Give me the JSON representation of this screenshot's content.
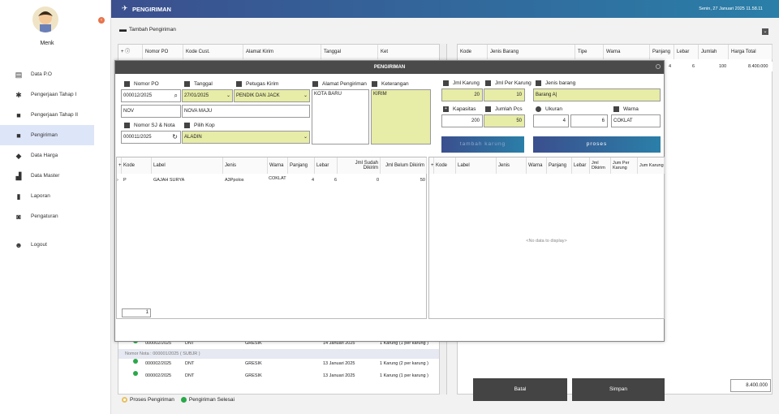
{
  "sidebar": {
    "user": "Menk",
    "items": [
      {
        "label": "Data P.O",
        "icon": "document-icon"
      },
      {
        "label": "Pengerjaan Tahap I",
        "icon": "gear-icon"
      },
      {
        "label": "Pengerjaan Tahap II",
        "icon": "truck-icon"
      },
      {
        "label": "Pengiriman",
        "icon": "truck-icon"
      },
      {
        "label": "Data Harga",
        "icon": "tag-icon"
      },
      {
        "label": "Data Master",
        "icon": "stamp-icon"
      },
      {
        "label": "Laporan",
        "icon": "chart-icon"
      },
      {
        "label": "Pengaturan",
        "icon": "settings-icon"
      },
      {
        "label": "Logout",
        "icon": "user-logout-icon"
      }
    ]
  },
  "topbar": {
    "title": "PENGIRIMAN",
    "datetime": "Senin, 27 Januari 2025  11.58.11"
  },
  "sub": {
    "add_label": "Tambah Pengiriman"
  },
  "left_table": {
    "headers": [
      "Nomor PO",
      "Kode Cust.",
      "Alamat Kirim",
      "Tanggal",
      "Ket"
    ],
    "rows": [
      {
        "po": "000002/2025",
        "cust": "DNT",
        "addr": "GRESIK",
        "date": "14 Januari 2025",
        "ket": "1 Karung (1 per karung )"
      },
      {
        "group": "Nomor Nota : 000001/2025  ( SUBJR )"
      },
      {
        "po": "000002/2025",
        "cust": "DNT",
        "addr": "GRESIK",
        "date": "13 Januari 2025",
        "ket": "1 Karung (2 per karung )"
      },
      {
        "po": "000002/2025",
        "cust": "DNT",
        "addr": "GRESIK",
        "date": "13 Januari 2025",
        "ket": "1 Karung (1 per karung )"
      }
    ]
  },
  "right_table": {
    "headers": [
      "Kode",
      "Jenis Barang",
      "Tipe",
      "Warna",
      "Panjang",
      "Lebar",
      "Jumlah",
      "Harga Total"
    ],
    "row": {
      "panjang": "4",
      "lebar": "6",
      "jumlah": "100",
      "harga": "8.400.000"
    },
    "total": "8.400.000"
  },
  "legend": {
    "proses": "Proses Pengiriman",
    "selesai": "Pengiriman Selesai"
  },
  "modal": {
    "title": "PENGIRIMAN",
    "labels": {
      "nomor_po": "Nomor PO",
      "tanggal": "Tanggal",
      "petugas": "Petugas Kirim",
      "alamat": "Alamat Pengiriman",
      "keterangan": "Keterangan",
      "nomor_sj": "Nomor SJ & Nota",
      "kop": "Pilih Kop",
      "jml_karung": "Jml Karung",
      "jml_per_karung": "Jml Per Karung",
      "jenis_barang": "Jenis barang",
      "kapasitas": "Kapasitas",
      "jumlah_pcs": "Jumlah Pcs",
      "ukuran": "Ukuran",
      "warna": "Warna"
    },
    "values": {
      "nomor_po": "000012/2025",
      "tanggal": "27/01/2025",
      "petugas": "PENDIK DAN JACK",
      "cust_code": "NOV",
      "cust_name": "NOVA MAJU",
      "nomor_sj": "000011/2025",
      "kop": "ALADIN",
      "alamat": "KOTA BARU",
      "keterangan": "KIRIM",
      "jml_karung": "20",
      "jml_per_karung": "10",
      "jenis_barang": "Barang A|",
      "kapasitas": "200",
      "jumlah_pcs": "50",
      "ukuran_a": "4",
      "ukuran_b": "6",
      "warna": "COKLAT"
    },
    "buttons": {
      "tambah": "tambah karung",
      "proses": "proses",
      "batal": "Batal",
      "simpan": "Simpan"
    },
    "left_grid": {
      "headers": [
        "Kode",
        "Label",
        "Jenis",
        "Warna",
        "Panjang",
        "Lebar",
        "Jml Sudah Dikirim",
        "Jml Belum Dikirim"
      ],
      "row": {
        "kode": "P",
        "label": "GAJAH SURYA",
        "jenis": "A3Ppolos",
        "warna": "COKLAT",
        "panjang": "4",
        "lebar": "6",
        "sudah": "0",
        "belum": "50"
      },
      "footer_count": "1"
    },
    "right_grid": {
      "headers": [
        "Kode",
        "Label",
        "Jenis",
        "Warna",
        "Panjang",
        "Lebar",
        "Jml Dikirim",
        "Jum Per Karung",
        "Jum Karung"
      ],
      "empty": "<No data to display>"
    }
  }
}
